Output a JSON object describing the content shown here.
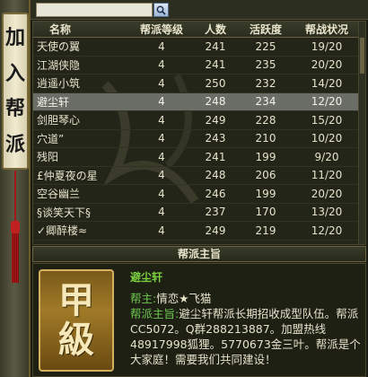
{
  "banner": {
    "chars": [
      "加",
      "入",
      "帮",
      "派"
    ]
  },
  "search": {
    "value": "",
    "placeholder": ""
  },
  "table": {
    "headers": {
      "name": "名称",
      "level": "帮派等级",
      "members": "人数",
      "activity": "活跃度",
      "war": "帮战状况"
    },
    "rows": [
      {
        "name": "天使の翼",
        "level": "4",
        "members": "241",
        "activity": "225",
        "war": "19/20"
      },
      {
        "name": "江湖侠隐",
        "level": "4",
        "members": "241",
        "activity": "235",
        "war": "20/20"
      },
      {
        "name": "逍遥小筑",
        "level": "4",
        "members": "250",
        "activity": "232",
        "war": "14/20"
      },
      {
        "name": "避尘轩",
        "level": "4",
        "members": "248",
        "activity": "234",
        "war": "12/20"
      },
      {
        "name": "剑胆琴心",
        "level": "4",
        "members": "249",
        "activity": "228",
        "war": "15/20"
      },
      {
        "name": "穴道”",
        "level": "4",
        "members": "243",
        "activity": "210",
        "war": "10/20"
      },
      {
        "name": "残阳",
        "level": "4",
        "members": "241",
        "activity": "199",
        "war": "9/20"
      },
      {
        "name": "£仲夏夜の星",
        "level": "4",
        "members": "248",
        "activity": "206",
        "war": "11/20"
      },
      {
        "name": "空谷幽兰",
        "level": "4",
        "members": "246",
        "activity": "199",
        "war": "20/20"
      },
      {
        "name": "§谈笑天下§",
        "level": "4",
        "members": "237",
        "activity": "170",
        "war": "13/20"
      },
      {
        "name": "✓卿醉楼≈",
        "level": "4",
        "members": "249",
        "activity": "219",
        "war": "12/20"
      }
    ],
    "selected_index": 3
  },
  "purpose": {
    "header": "帮派主旨",
    "guild_name": "避尘轩",
    "emblem_chars": [
      "甲",
      "級"
    ],
    "leader_label": "帮主:",
    "leader_value": "情恋★飞猫",
    "purpose_label": "帮派主旨:",
    "purpose_text": "避尘轩帮派长期招收成型队伍。帮派CC5072。Q群288213887。加盟热线48917998狐狸。5770673金三叶。帮派是个大家庭！需要我们共同建设！"
  },
  "colors": {
    "accent_green": "#6ec850",
    "selected_row": "#6a6e66",
    "emblem_gold": "#a07a28"
  }
}
